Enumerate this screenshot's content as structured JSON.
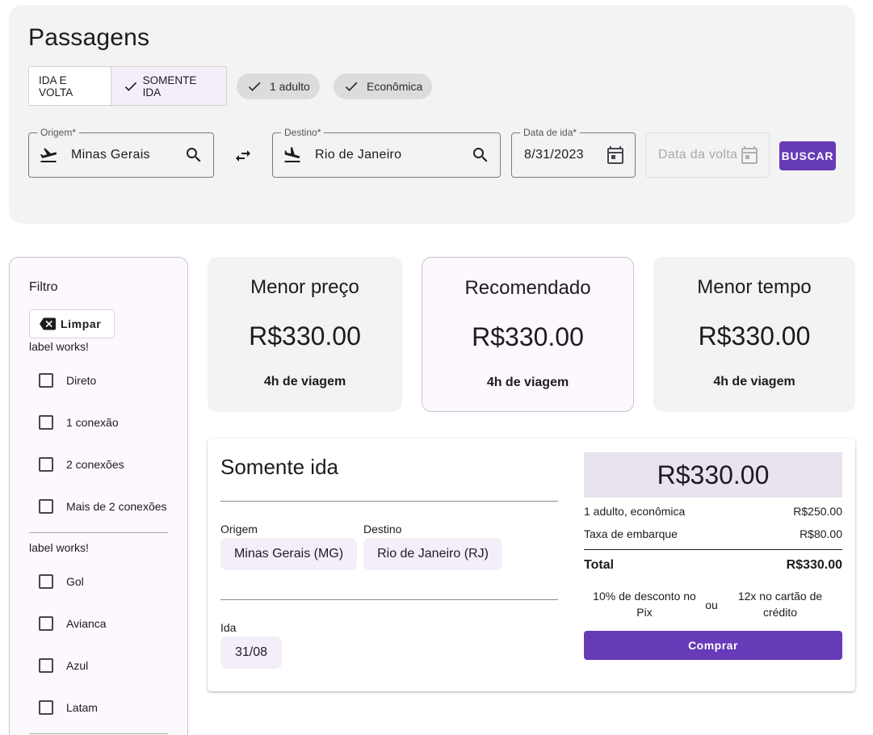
{
  "search": {
    "title": "Passagens",
    "trip_type": {
      "round_trip": "IDA E VOLTA",
      "one_way": "SOMENTE IDA",
      "selected": "one_way"
    },
    "passengers_chip": "1 adulto",
    "class_chip": "Econômica",
    "origin": {
      "label": "Origem*",
      "value": "Minas Gerais",
      "icon": "flight-takeoff-icon"
    },
    "destination": {
      "label": "Destino*",
      "value": "Rio de Janeiro",
      "icon": "flight-land-icon"
    },
    "depart_date": {
      "label": "Data de ida*",
      "value": "8/31/2023"
    },
    "return_date": {
      "placeholder": "Data da volta",
      "disabled": true
    },
    "search_button": "BUSCAR"
  },
  "filters": {
    "title": "Filtro",
    "clear_button": "Limpar",
    "groups": [
      {
        "label": "label works!",
        "options": [
          "Direto",
          "1 conexão",
          "2 conexões",
          "Mais de 2 conexões"
        ]
      },
      {
        "label": "label works!",
        "options": [
          "Gol",
          "Avianca",
          "Azul",
          "Latam"
        ]
      }
    ]
  },
  "summary_cards": [
    {
      "title": "Menor preço",
      "price": "R$330.00",
      "duration": "4h de viagem"
    },
    {
      "title": "Recomendado",
      "price": "R$330.00",
      "duration": "4h de viagem",
      "highlighted": true
    },
    {
      "title": "Menor tempo",
      "price": "R$330.00",
      "duration": "4h de viagem"
    }
  ],
  "flight": {
    "title": "Somente ida",
    "origin_label": "Origem",
    "origin_value": "Minas Gerais (MG)",
    "destination_label": "Destino",
    "destination_value": "Rio de Janeiro (RJ)",
    "ida_label": "Ida",
    "ida_value": "31/08",
    "price": "R$330.00",
    "breakdown": [
      {
        "label": "1 adulto, econômica",
        "value": "R$250.00"
      },
      {
        "label": "Taxa de embarque",
        "value": "R$80.00"
      }
    ],
    "total_label": "Total",
    "total_value": "R$330.00",
    "pix_discount": "10% de desconto no Pix",
    "or_label": "ou",
    "installments": "12x no cartão de crédito",
    "buy_button": "Comprar"
  },
  "colors": {
    "primary": "#673ab7",
    "panel_bg": "#f3f3f3",
    "tint_bg": "#fdf7fe"
  }
}
